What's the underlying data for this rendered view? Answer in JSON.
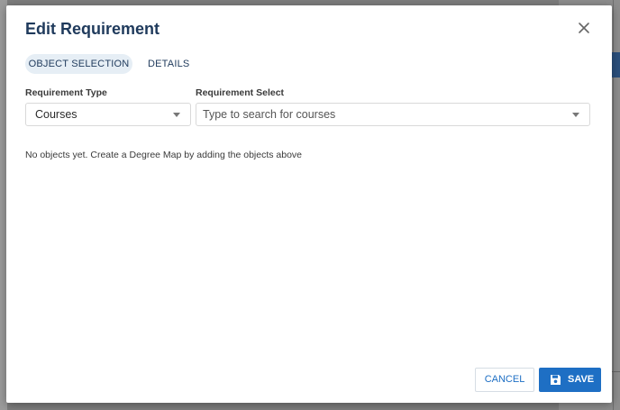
{
  "modal": {
    "title": "Edit Requirement",
    "tabs": [
      {
        "label": "OBJECT SELECTION",
        "active": true
      },
      {
        "label": "DETAILS",
        "active": false
      }
    ],
    "requirement_type": {
      "label": "Requirement Type",
      "value": "Courses"
    },
    "requirement_select": {
      "label": "Requirement Select",
      "placeholder": "Type to search for courses"
    },
    "empty_message": "No objects yet. Create a Degree Map by adding the objects above",
    "buttons": {
      "cancel": "CANCEL",
      "save": "SAVE"
    }
  },
  "colors": {
    "accent": "#1e6fc4",
    "title": "#1f3a5c",
    "active_tab_bg": "#e6eef5"
  },
  "icons": {
    "close": "close-icon",
    "save": "floppy-disk-icon",
    "dropdown": "chevron-down-icon"
  }
}
